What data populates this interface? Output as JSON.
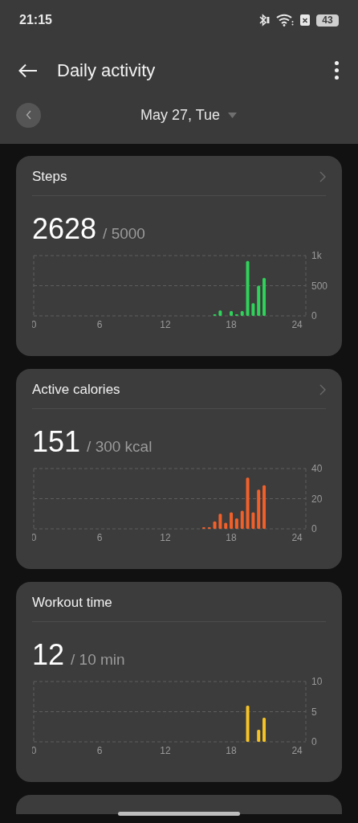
{
  "status_bar": {
    "time": "21:15",
    "battery": "43"
  },
  "app_bar": {
    "title": "Daily activity"
  },
  "date_selector": {
    "date": "May 27, Tue"
  },
  "cards": [
    {
      "title": "Steps",
      "value": "2628",
      "goal": "/ 5000",
      "chevron": true,
      "chart_data": {
        "type": "bar",
        "x": [
          16.5,
          17,
          18,
          18.5,
          19,
          19.5,
          20,
          20.5,
          21
        ],
        "xlim": [
          0,
          24.8
        ],
        "ylim": [
          0,
          1000
        ],
        "xticks": [
          0,
          6,
          12,
          18,
          24
        ],
        "yticks": [
          0,
          500,
          {
            "value": 1000,
            "label": "1k"
          }
        ],
        "series": [
          {
            "color": "#2fd25a",
            "values": [
              20,
              90,
              80,
              20,
              80,
              910,
              210,
              500,
              630
            ]
          }
        ]
      }
    },
    {
      "title": "Active calories",
      "value": "151",
      "goal": "/ 300 kcal",
      "chevron": true,
      "chart_data": {
        "type": "bar",
        "x": [
          15.5,
          16,
          16.5,
          17,
          17.5,
          18,
          18.5,
          19,
          19.5,
          20,
          20.5,
          21
        ],
        "xlim": [
          0,
          24.8
        ],
        "ylim": [
          0,
          40
        ],
        "xticks": [
          0,
          6,
          12,
          18,
          24
        ],
        "yticks": [
          0,
          20,
          40
        ],
        "series": [
          {
            "color": "#f2602a",
            "values": [
              1,
              1,
              5,
              10,
              4,
              11,
              7,
              12,
              34,
              11,
              26,
              29
            ]
          }
        ]
      }
    },
    {
      "title": "Workout time",
      "value": "12",
      "goal": "/ 10 min",
      "chevron": false,
      "chart_data": {
        "type": "bar",
        "x": [
          19.5,
          20.5,
          21
        ],
        "xlim": [
          0,
          24.8
        ],
        "ylim": [
          0,
          10
        ],
        "xticks": [
          0,
          6,
          12,
          18,
          24
        ],
        "yticks": [
          0,
          5,
          10
        ],
        "series": [
          {
            "color": "#f6c326",
            "values": [
              6,
              2,
              4
            ]
          }
        ]
      }
    }
  ]
}
